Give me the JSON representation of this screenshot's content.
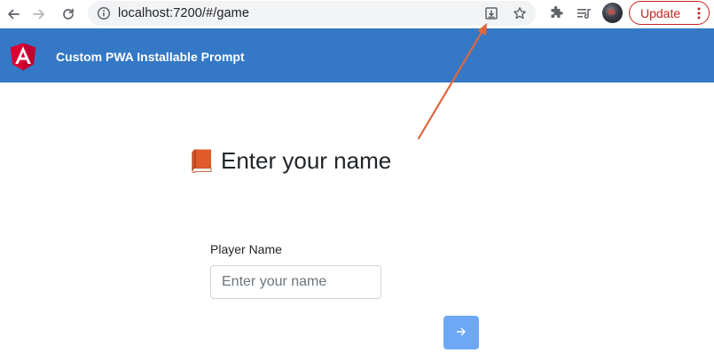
{
  "browser": {
    "url": "localhost:7200/#/game",
    "update_label": "Update",
    "icons": [
      "back-icon",
      "forward-icon",
      "reload-icon",
      "site-info-icon",
      "install-app-icon",
      "bookmark-star-icon",
      "extensions-icon",
      "reading-list-icon",
      "profile-avatar",
      "more-menu-icon"
    ],
    "update_color": "#c5221f"
  },
  "app": {
    "title": "Custom PWA Installable Prompt",
    "header_color": "#3478c6",
    "logo": "angular-logo"
  },
  "main": {
    "heading": "Enter your name",
    "heading_icon": "book-emoji-icon",
    "field_label": "Player Name",
    "input_placeholder": "Enter your name",
    "input_value": "",
    "submit_icon": "arrow-right-icon",
    "submit_color": "#6ea8f4"
  },
  "annotation": {
    "type": "arrow",
    "color": "#e0663c",
    "points_to": "install-app-icon"
  }
}
